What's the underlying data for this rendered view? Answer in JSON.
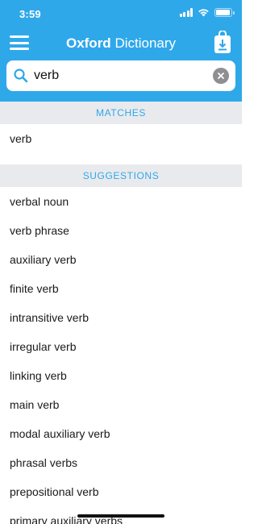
{
  "status_bar": {
    "time": "3:59",
    "battery_level": 0.95
  },
  "header": {
    "title_brand": "Oxford",
    "title_rest": "Dictionary",
    "menu_icon": "hamburger-menu-icon",
    "download_icon": "download-bag-icon",
    "color": "#2fa8ea"
  },
  "search": {
    "value": "verb",
    "placeholder": ""
  },
  "matches": {
    "header": "MATCHES",
    "items": [
      "verb"
    ]
  },
  "suggestions": {
    "header": "SUGGESTIONS",
    "items": [
      "verbal noun",
      "verb phrase",
      "auxiliary verb",
      "finite verb",
      "intransitive verb",
      "irregular verb",
      "linking verb",
      "main verb",
      "modal auxiliary verb",
      "phrasal verbs",
      "prepositional verb",
      "primary auxiliary verbs"
    ]
  }
}
